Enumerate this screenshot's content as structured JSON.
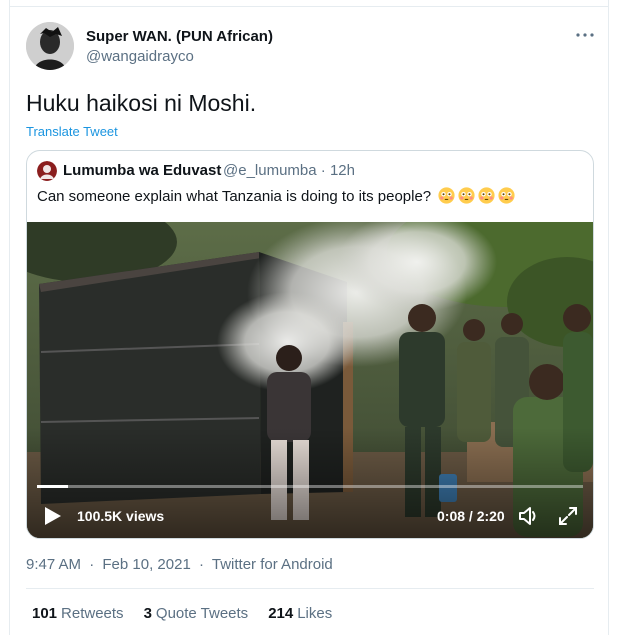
{
  "tweet": {
    "author_name": "Super WAN. (PUN African)",
    "author_handle": "@wangaidrayco",
    "text": "Huku haikosi ni Moshi.",
    "translate_label": "Translate Tweet"
  },
  "quoted_tweet": {
    "author_name": "Lumumba wa Eduvast",
    "author_handle": "@e_lumumba",
    "age": "12h",
    "separator": "·",
    "text": "Can someone explain what Tanzania is doing to its people?",
    "emojis": [
      "flushed-face-icon",
      "flushed-face-icon",
      "flushed-face-icon",
      "flushed-face-icon"
    ]
  },
  "video": {
    "views": "100.5K views",
    "time": "0:08 / 2:20",
    "progress_fraction": 0.057
  },
  "meta": {
    "time": "9:47 AM",
    "date": "Feb 10, 2021",
    "source": "Twitter for Android",
    "separator": "·"
  },
  "stats": {
    "retweets_count": "101",
    "retweets_label": "Retweets",
    "quotes_count": "3",
    "quotes_label": "Quote Tweets",
    "likes_count": "214",
    "likes_label": "Likes"
  },
  "colors": {
    "link": "#1b95e0",
    "secondary_text": "#5b7083",
    "border": "#cfd9de"
  }
}
